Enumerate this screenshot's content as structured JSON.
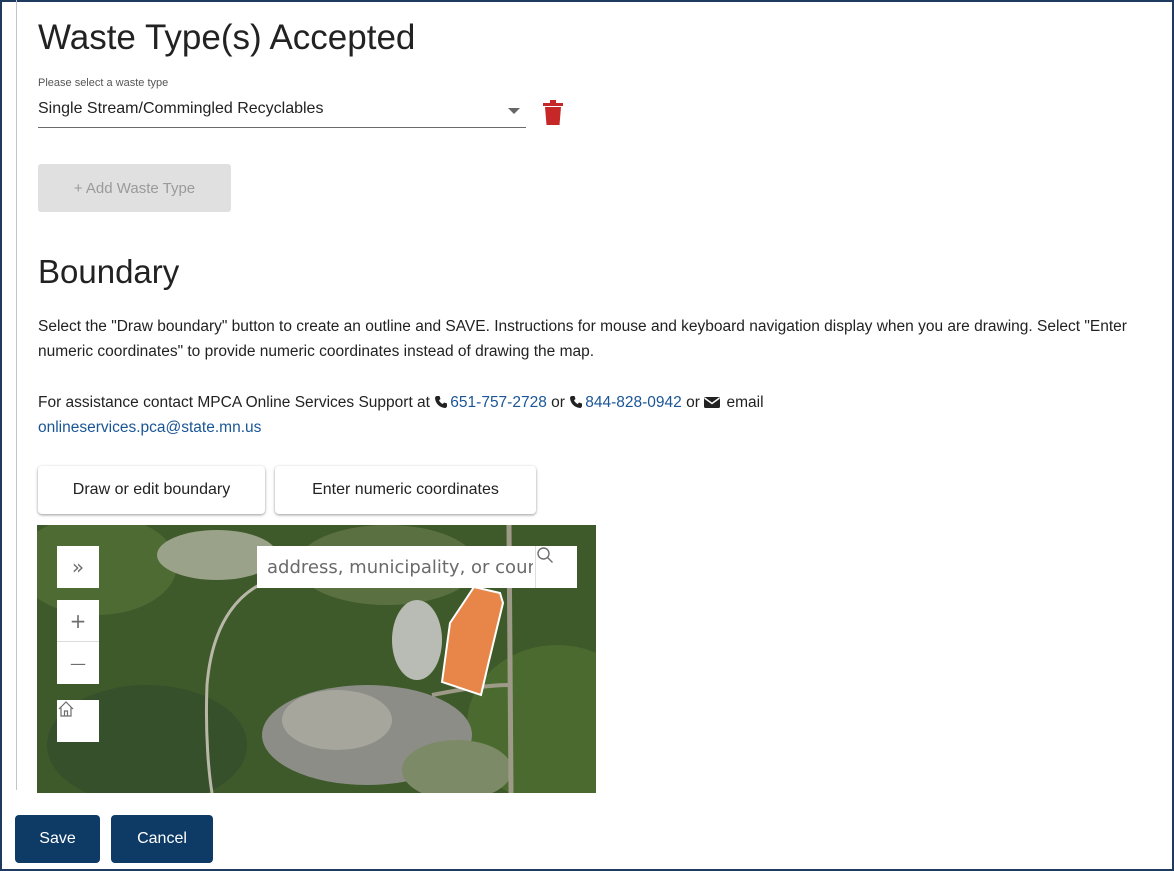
{
  "waste": {
    "title": "Waste Type(s) Accepted",
    "select_label": "Please select a waste type",
    "selected_value": "Single Stream/Commingled Recyclables",
    "add_button": "+ Add Waste Type"
  },
  "boundary": {
    "title": "Boundary",
    "instructions": "Select the \"Draw boundary\" button to create an outline and SAVE. Instructions for mouse and keyboard navigation display when you are drawing. Select \"Enter numeric coordinates\" to provide numeric coordinates instead of drawing the map.",
    "assist_prefix": "For assistance contact MPCA Online Services Support at ",
    "phone1": "651-757-2728",
    "or1": " or ",
    "phone2": "844-828-0942",
    "or2": " or ",
    "email_word": " email",
    "email": "onlineservices.pca@state.mn.us",
    "draw_button": "Draw or edit boundary",
    "numeric_button": "Enter numeric coordinates"
  },
  "map": {
    "search_placeholder": "address, municipality, or county",
    "expand_glyph": "»",
    "zoom_in_glyph": "+",
    "zoom_out_glyph": "—",
    "polygon_color": "#e8864a"
  },
  "footer": {
    "save": "Save",
    "cancel": "Cancel"
  },
  "icons": {
    "delete": "trash-icon",
    "phone": "phone-icon",
    "email": "envelope-icon",
    "search": "search-icon",
    "home": "home-icon"
  },
  "colors": {
    "primary": "#0d3b66",
    "link": "#1a5596",
    "danger": "#c62828"
  }
}
